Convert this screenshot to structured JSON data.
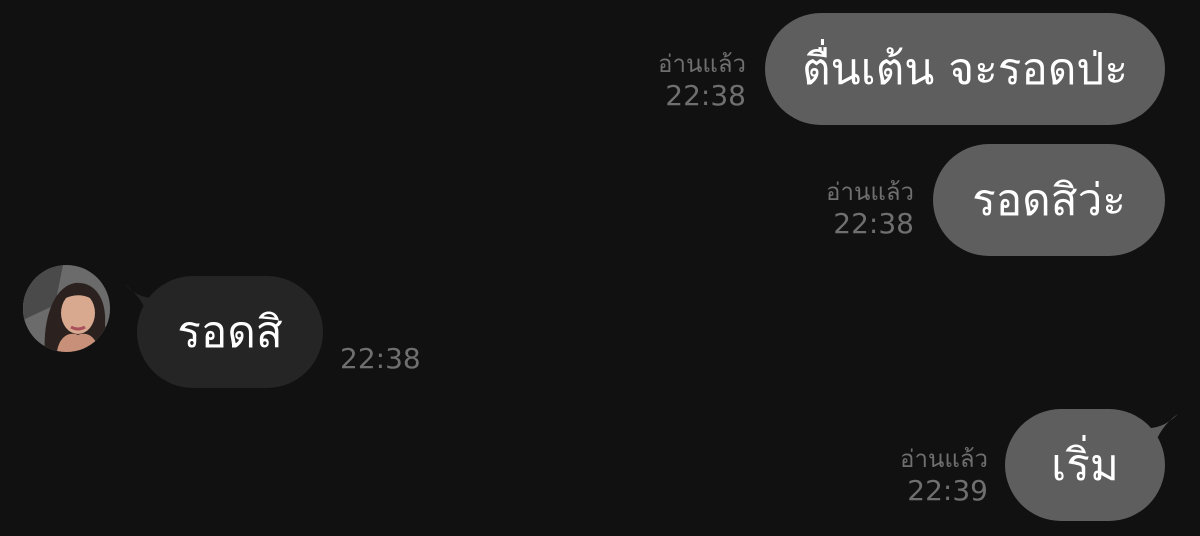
{
  "messages": [
    {
      "direction": "outgoing",
      "text": "ตื่นเต้น จะรอดป่ะ",
      "read_label": "อ่านแล้ว",
      "time": "22:38"
    },
    {
      "direction": "outgoing",
      "text": "รอดสิว่ะ",
      "read_label": "อ่านแล้ว",
      "time": "22:38"
    },
    {
      "direction": "incoming",
      "text": "รอดสิ",
      "time": "22:38"
    },
    {
      "direction": "outgoing",
      "text": "เริ่ม",
      "read_label": "อ่านแล้ว",
      "time": "22:39"
    }
  ],
  "colors": {
    "background": "#111111",
    "outgoing_bubble": "#5e5e5e",
    "incoming_bubble": "#252525",
    "meta_text": "#6f6f6f",
    "bubble_text": "#ffffff"
  },
  "contact": {
    "avatar_icon": "contact-avatar-photo"
  }
}
